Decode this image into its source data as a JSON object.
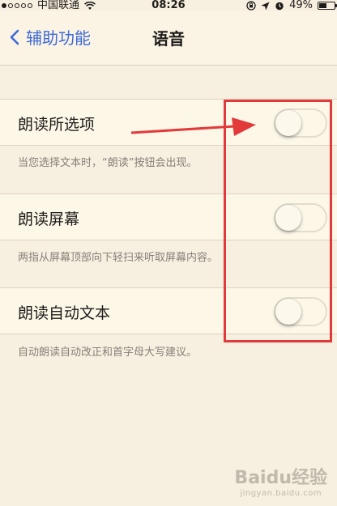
{
  "status_bar": {
    "carrier": "中国联通",
    "time": "08:26",
    "battery": "49%",
    "battery_level": 0.49,
    "signal_strength": 1,
    "icons": [
      "wifi-icon",
      "lock-rotation-icon",
      "location-arrow-icon",
      "alarm-icon",
      "battery-icon"
    ]
  },
  "nav": {
    "back_label": "辅助功能",
    "title": "语音"
  },
  "settings": [
    {
      "label": "朗读所选项",
      "on": false,
      "note": "当您选择文本时，“朗读”按钮会出现。"
    },
    {
      "label": "朗读屏幕",
      "on": false,
      "note": "两指从屏幕顶部向下轻扫来听取屏幕内容。"
    },
    {
      "label": "朗读自动文本",
      "on": false,
      "note": "自动朗读自动改正和首字母大写建议。"
    }
  ],
  "annotation": {
    "color": "#e23a3a"
  },
  "watermark": {
    "main": "Baidu经验",
    "sub": "jingyan.baidu.com"
  },
  "colors": {
    "accent": "#3d6ad6",
    "background": "#f7efdf"
  }
}
